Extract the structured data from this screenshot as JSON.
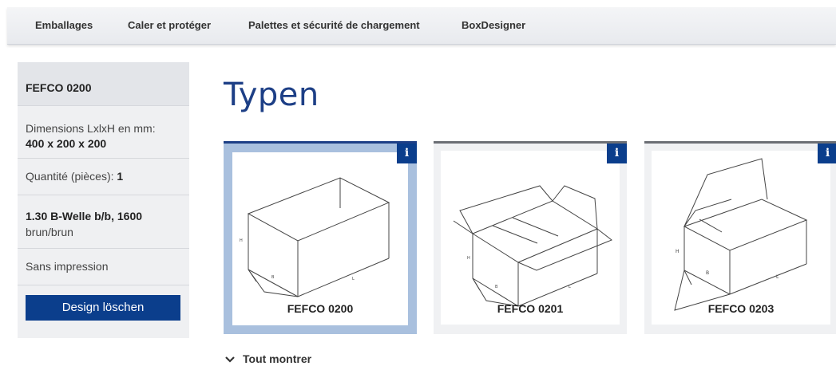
{
  "nav": {
    "items": [
      "Emballages",
      "Caler et protéger",
      "Palettes et sécurité de chargement",
      "BoxDesigner"
    ]
  },
  "sidebar": {
    "title": "FEFCO 0200",
    "dims_label": "Dimensions LxlxH en mm:",
    "dims_value": "400 x 200 x 200",
    "qty_label": "Quantité (pièces):",
    "qty_value": "1",
    "material_bold": "1.30 B-Welle b/b, 1600",
    "material_rest": "brun/brun",
    "print": "Sans impression",
    "delete_button": "Design löschen"
  },
  "main": {
    "title": "Typen",
    "cards": [
      {
        "label": "FEFCO 0200",
        "info": "i",
        "selected": true
      },
      {
        "label": "FEFCO 0201",
        "info": "i",
        "selected": false
      },
      {
        "label": "FEFCO 0203",
        "info": "i",
        "selected": false
      }
    ],
    "show_all": "Tout montrer"
  },
  "colors": {
    "accent": "#0b3e8c",
    "heading": "#1d3f86",
    "selected_frame": "#a9c0de"
  }
}
